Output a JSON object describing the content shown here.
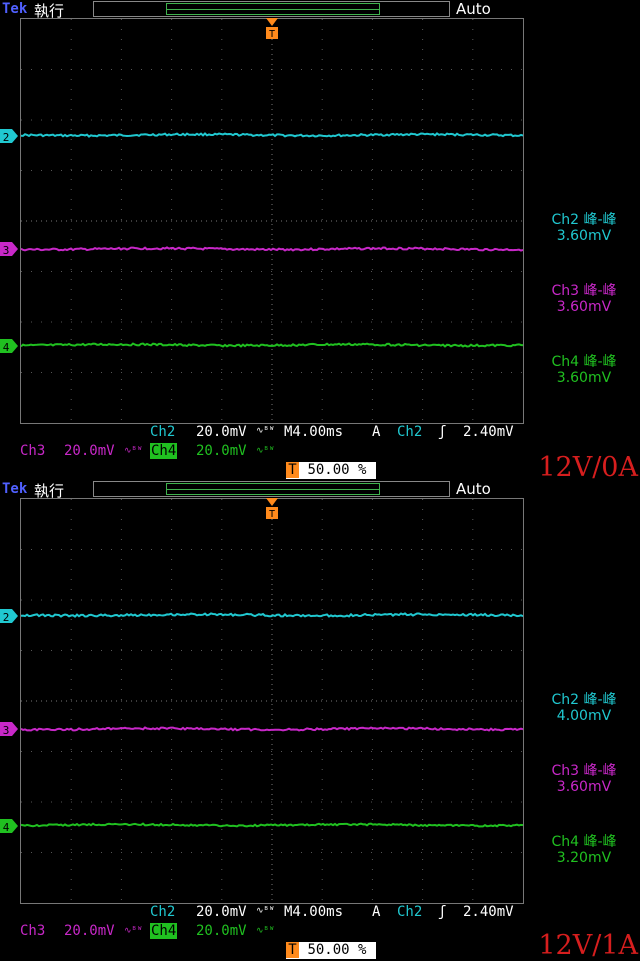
{
  "panels": [
    {
      "top": {
        "brand": "Tek",
        "mode": "執行",
        "trigger_state": "Auto"
      },
      "right_readouts": [
        {
          "label": "Ch2 峰-峰",
          "value": "3.60mV",
          "color": "#20c8d0"
        },
        {
          "label": "Ch3 峰-峰",
          "value": "3.60mV",
          "color": "#c828c8"
        },
        {
          "label": "Ch4 峰-峰",
          "value": "3.60mV",
          "color": "#20c020"
        }
      ],
      "bottom": {
        "ch2": "Ch2",
        "ch2_scale": "20.0mV",
        "timebase": "M4.00ms",
        "acq": "A",
        "trig_source": "Ch2",
        "trig_level": "2.40mV",
        "ch3": "Ch3",
        "ch3_scale": "20.0mV",
        "ch4": "Ch4",
        "ch4_scale": "20.0mV",
        "trig_pos": "50.00 %"
      },
      "annotation": "12V/0A"
    },
    {
      "top": {
        "brand": "Tek",
        "mode": "執行",
        "trigger_state": "Auto"
      },
      "right_readouts": [
        {
          "label": "Ch2 峰-峰",
          "value": "4.00mV",
          "color": "#20c8d0"
        },
        {
          "label": "Ch3 峰-峰",
          "value": "3.60mV",
          "color": "#c828c8"
        },
        {
          "label": "Ch4 峰-峰",
          "value": "3.20mV",
          "color": "#20c020"
        }
      ],
      "bottom": {
        "ch2": "Ch2",
        "ch2_scale": "20.0mV",
        "timebase": "M4.00ms",
        "acq": "A",
        "trig_source": "Ch2",
        "trig_level": "2.40mV",
        "ch3": "Ch3",
        "ch3_scale": "20.0mV",
        "ch4": "Ch4",
        "ch4_scale": "20.0mV",
        "trig_pos": "50.00 %"
      },
      "annotation": "12V/1A"
    }
  ],
  "chart_data": [
    {
      "type": "line",
      "title": "",
      "xlabel": "",
      "ylabel": "",
      "grid": true,
      "series": [
        {
          "name": "Ch2",
          "values": [
            3.6
          ],
          "color": "#20c8d0"
        },
        {
          "name": "Ch3",
          "values": [
            3.6
          ],
          "color": "#c828c8"
        },
        {
          "name": "Ch4",
          "values": [
            3.6
          ],
          "color": "#20c020"
        }
      ]
    },
    {
      "type": "line",
      "title": "",
      "xlabel": "",
      "ylabel": "",
      "grid": true,
      "series": [
        {
          "name": "Ch2",
          "values": [
            4.0
          ],
          "color": "#20c8d0"
        },
        {
          "name": "Ch3",
          "values": [
            3.6
          ],
          "color": "#c828c8"
        },
        {
          "name": "Ch4",
          "values": [
            3.2
          ],
          "color": "#20c020"
        }
      ]
    }
  ]
}
